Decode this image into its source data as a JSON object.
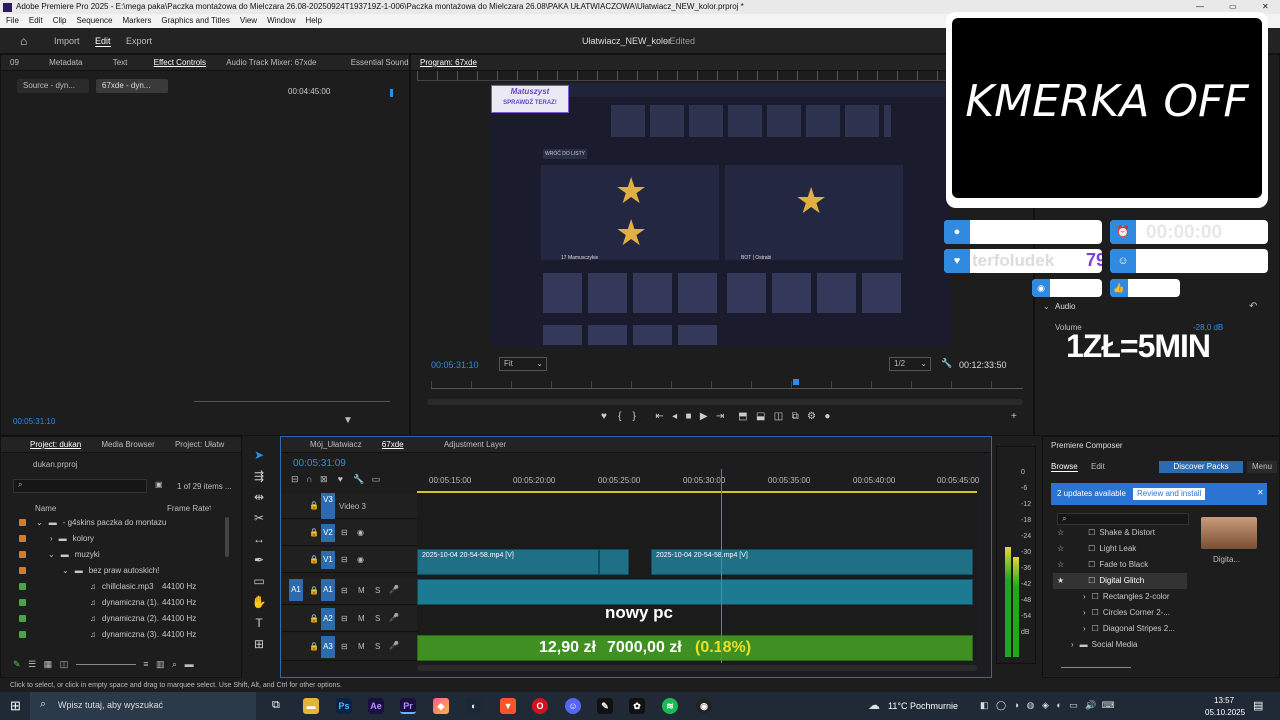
{
  "window": {
    "title": "Adobe Premiere Pro 2025 - E:\\mega paka\\Paczka montażowa do Mielczara 26.08-20250924T193719Z-1-006\\Paczka montażowa do Mielczara 26.08\\PAKA UŁATWIACZOWA\\Ułatwiacz_NEW_kolor.prproj *"
  },
  "menu": [
    "File",
    "Edit",
    "Clip",
    "Sequence",
    "Markers",
    "Graphics and Titles",
    "View",
    "Window",
    "Help"
  ],
  "nav": {
    "import": "Import",
    "edit": "Edit",
    "export": "Export",
    "project_name": "Ułatwiacz_NEW_kolor",
    "status": "- Edited"
  },
  "source_panel": {
    "tabs": [
      "09",
      "Metadata",
      "Text",
      "Effect Controls",
      "Audio Track Mixer: 67xde",
      "Essential Sound"
    ],
    "sub_tabs": [
      "Source - dyn...",
      "67xde - dyn..."
    ],
    "ruler_time": "00:04:45:00",
    "timecode": "00:05:31:10"
  },
  "program": {
    "tab": "Program: 67xde",
    "timecode_left": "00:05:31:10",
    "fit": "Fit",
    "quality": "1/2",
    "timecode_right": "00:12:33:50"
  },
  "overlay": {
    "kamera_text": "KMERKA OFF",
    "timer": "00:00:00",
    "donor": "terfoludek",
    "donor_count": "79",
    "rate": "1ZŁ=5MIN"
  },
  "audio_panel": {
    "title": "Audio",
    "volume_label": "Volume",
    "volume_value": "-28,0 dB"
  },
  "video": {
    "banner_name": "Matuszyst",
    "banner_cta": "SPRAWDŹ TERAZ!",
    "back": "WRÓĆ DO LISTY",
    "left_player": "17 Mamusczykie",
    "right_player": "BOT | Ostrabi"
  },
  "project": {
    "tabs": [
      "Project: dukan",
      "Media Browser",
      "Project: Ułatw"
    ],
    "file": "dukan.prproj",
    "count": "1 of 29 items ...",
    "col_name": "Name",
    "col_rate": "Frame Rate",
    "items": [
      {
        "name": "- g4skins paczka do montazu",
        "rate": "",
        "color": "#d87a2c",
        "indent": 1
      },
      {
        "name": "kolory",
        "rate": "",
        "color": "#d87a2c",
        "indent": 2
      },
      {
        "name": "muzyki",
        "rate": "",
        "color": "#d87a2c",
        "indent": 2
      },
      {
        "name": "bez praw autoskich!",
        "rate": "",
        "color": "#d87a2c",
        "indent": 3
      },
      {
        "name": "chillclasic.mp3",
        "rate": "44100 Hz",
        "color": "#4aa54a",
        "indent": 4
      },
      {
        "name": "dynamiczna (1).",
        "rate": "44100 Hz",
        "color": "#4aa54a",
        "indent": 4
      },
      {
        "name": "dynamiczna (2).",
        "rate": "44100 Hz",
        "color": "#4aa54a",
        "indent": 4
      },
      {
        "name": "dynamiczna (3).",
        "rate": "44100 Hz",
        "color": "#4aa54a",
        "indent": 4
      }
    ]
  },
  "timeline": {
    "tabs": [
      "Mój_Ułatwiacz",
      "67xde",
      "Adjustment Layer"
    ],
    "timecode": "00:05:31:09",
    "ruler": [
      "00:05:15:00",
      "00:05:20:00",
      "00:05:25:00",
      "00:05:30:00",
      "00:05:35:00",
      "00:05:40:00",
      "00:05:45:00"
    ],
    "tracks": [
      "V3",
      "V2",
      "V1",
      "A1",
      "A2",
      "A3"
    ],
    "video3_label": "Video 3",
    "clip_v1_a": "2025-10-04 20-54-58.mp4 [V]",
    "clip_v1_b": "2025-10-04 20-54-58.mp4 [V]",
    "caption_1": "nowy pc",
    "caption_2": "12,90 zł",
    "caption_3": "7000,00 zł",
    "caption_4": "(0.18%)"
  },
  "meter": {
    "labels": [
      "0",
      "-6",
      "-12",
      "-18",
      "-24",
      "-30",
      "-36",
      "-42",
      "-48",
      "-54",
      "dB"
    ]
  },
  "composer": {
    "title": "Premiere Composer",
    "browse": "Browse",
    "edit": "Edit",
    "discover": "Discover Packs",
    "menu": "Menu",
    "updates": "2 updates available",
    "review": "Review and install",
    "list": [
      "Shake & Distort",
      "Light Leak",
      "Fade to Black",
      "Digital Glitch",
      "Rectangles 2-color",
      "Circles Corner 2-...",
      "Diagonal Stripes 2...",
      "Social Media"
    ],
    "thumb_label": "Digita..."
  },
  "status": "Click to select, or click in empty space and drag to marquee select. Use Shift, Alt, and Ctrl for other options.",
  "taskbar": {
    "search": "Wpisz tutaj, aby wyszukać",
    "weather": "11°C  Pochmurnie",
    "time": "13:57",
    "date": "05.10.2025"
  },
  "colors": {
    "accent": "#2d8ceb",
    "clip_video": "#1f6f86",
    "clip_audio": "#1c7a93",
    "clip_music": "#3f8f22",
    "overlay_blue": "#2f8ae0"
  }
}
